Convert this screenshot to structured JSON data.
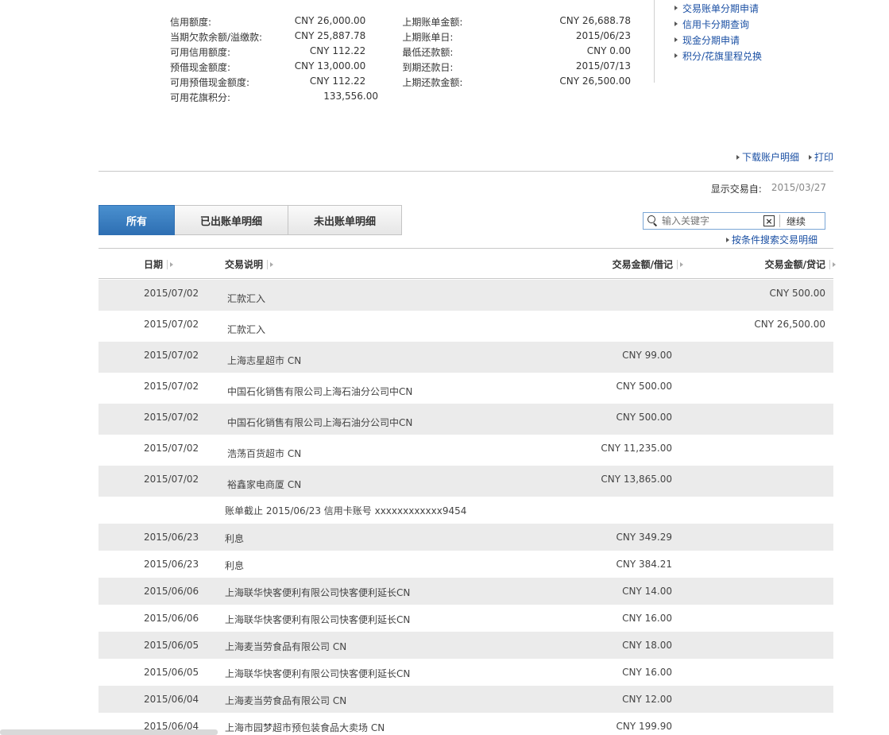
{
  "summary": {
    "left": [
      {
        "label": "信用额度:",
        "value": "CNY 26,000.00"
      },
      {
        "label": "当期欠款余额/溢缴款:",
        "value": "CNY 25,887.78"
      },
      {
        "label": "可用信用额度:",
        "value": "CNY 112.22"
      },
      {
        "label": "预借现金额度:",
        "value": "CNY 13,000.00"
      },
      {
        "label": "可用预借现金额度:",
        "value": "CNY 112.22"
      },
      {
        "label": "可用花旗积分:",
        "value": "133,556.00"
      }
    ],
    "right": [
      {
        "label": "上期账单金额:",
        "value": "CNY 26,688.78"
      },
      {
        "label": "上期账单日:",
        "value": "2015/06/23"
      },
      {
        "label": "最低还款额:",
        "value": "CNY 0.00"
      },
      {
        "label": "到期还款日:",
        "value": "2015/07/13"
      },
      {
        "label": "上期还款金额:",
        "value": "CNY 26,500.00"
      }
    ]
  },
  "quick_links": [
    "交易账单分期申请",
    "信用卡分期查询",
    "现金分期申请",
    "积分/花旗里程兑换"
  ],
  "actions": {
    "download": "下载账户明细",
    "print": "打印"
  },
  "since": {
    "label": "显示交易自:",
    "value": "2015/03/27"
  },
  "tabs": [
    "所有",
    "已出账单明细",
    "未出账单明细"
  ],
  "search": {
    "placeholder": "输入关键字",
    "clear": "×",
    "go": "继续",
    "advanced": "按条件搜索交易明细"
  },
  "table": {
    "headers": {
      "date": "日期",
      "desc": "交易说明",
      "debit": "交易金额/借记",
      "credit": "交易金额/贷记"
    },
    "rows": [
      {
        "date": "2015/07/02",
        "desc": "汇款汇入",
        "debit": "",
        "credit": "CNY 500.00"
      },
      {
        "date": "2015/07/02",
        "desc": "汇款汇入",
        "debit": "",
        "credit": "CNY 26,500.00"
      },
      {
        "date": "2015/07/02",
        "desc": "上海志星超市 CN",
        "debit": "CNY 99.00",
        "credit": ""
      },
      {
        "date": "2015/07/02",
        "desc": "中国石化销售有限公司上海石油分公司中CN",
        "debit": "CNY 500.00",
        "credit": ""
      },
      {
        "date": "2015/07/02",
        "desc": "中国石化销售有限公司上海石油分公司中CN",
        "debit": "CNY 500.00",
        "credit": ""
      },
      {
        "date": "2015/07/02",
        "desc": "浩荡百货超市 CN",
        "debit": "CNY 11,235.00",
        "credit": ""
      },
      {
        "date": "2015/07/02",
        "desc": "裕鑫家电商厦 CN",
        "debit": "CNY 13,865.00",
        "credit": ""
      },
      {
        "note": "账单截止 2015/06/23 信用卡账号 xxxxxxxxxxxx9454"
      },
      {
        "date": "2015/06/23",
        "desc": "利息",
        "debit": "CNY 349.29",
        "credit": ""
      },
      {
        "date": "2015/06/23",
        "desc": "利息",
        "debit": "CNY 384.21",
        "credit": ""
      },
      {
        "date": "2015/06/06",
        "desc": "上海联华快客便利有限公司快客便利延长CN",
        "debit": "CNY 14.00",
        "credit": ""
      },
      {
        "date": "2015/06/06",
        "desc": "上海联华快客便利有限公司快客便利延长CN",
        "debit": "CNY 16.00",
        "credit": ""
      },
      {
        "date": "2015/06/05",
        "desc": "上海麦当劳食品有限公司 CN",
        "debit": "CNY 18.00",
        "credit": ""
      },
      {
        "date": "2015/06/05",
        "desc": "上海联华快客便利有限公司快客便利延长CN",
        "debit": "CNY 16.00",
        "credit": ""
      },
      {
        "date": "2015/06/04",
        "desc": "上海麦当劳食品有限公司 CN",
        "debit": "CNY 12.00",
        "credit": ""
      },
      {
        "date": "2015/06/04",
        "desc": "上海市园梦超市预包装食品大卖场 CN",
        "debit": "CNY 199.90",
        "credit": ""
      }
    ]
  }
}
